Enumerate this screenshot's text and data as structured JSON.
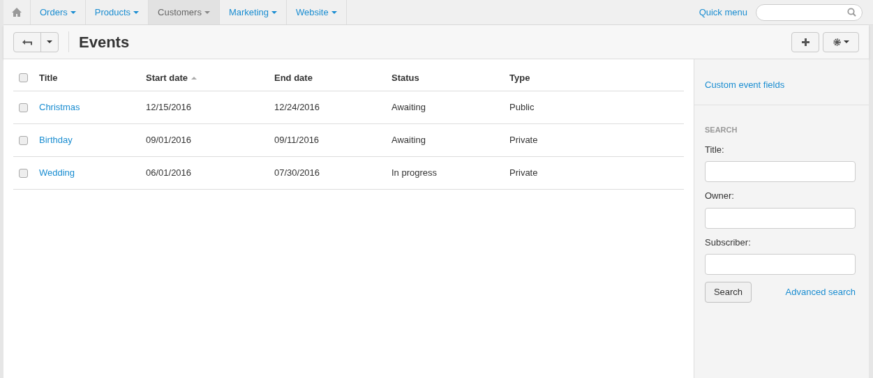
{
  "nav": {
    "items": [
      {
        "label": "Orders",
        "selected": false
      },
      {
        "label": "Products",
        "selected": false
      },
      {
        "label": "Customers",
        "selected": true
      },
      {
        "label": "Marketing",
        "selected": false
      },
      {
        "label": "Website",
        "selected": false
      }
    ],
    "quick_menu": "Quick menu"
  },
  "header": {
    "title": "Events"
  },
  "table": {
    "select_all_checked": false,
    "columns": [
      {
        "label": "Title",
        "sorted": false
      },
      {
        "label": "Start date",
        "sorted": true
      },
      {
        "label": "End date",
        "sorted": false
      },
      {
        "label": "Status",
        "sorted": false
      },
      {
        "label": "Type",
        "sorted": false
      }
    ],
    "rows": [
      {
        "checked": false,
        "title": "Christmas",
        "start": "12/15/2016",
        "end": "12/24/2016",
        "status": "Awaiting",
        "type": "Public"
      },
      {
        "checked": false,
        "title": "Birthday",
        "start": "09/01/2016",
        "end": "09/11/2016",
        "status": "Awaiting",
        "type": "Private"
      },
      {
        "checked": false,
        "title": "Wedding",
        "start": "06/01/2016",
        "end": "07/30/2016",
        "status": "In progress",
        "type": "Private"
      }
    ]
  },
  "sidebar": {
    "link": "Custom event fields",
    "search": {
      "heading": "SEARCH",
      "fields": [
        {
          "label": "Title:"
        },
        {
          "label": "Owner:"
        },
        {
          "label": "Subscriber:"
        }
      ],
      "button": "Search",
      "advanced": "Advanced search"
    }
  }
}
